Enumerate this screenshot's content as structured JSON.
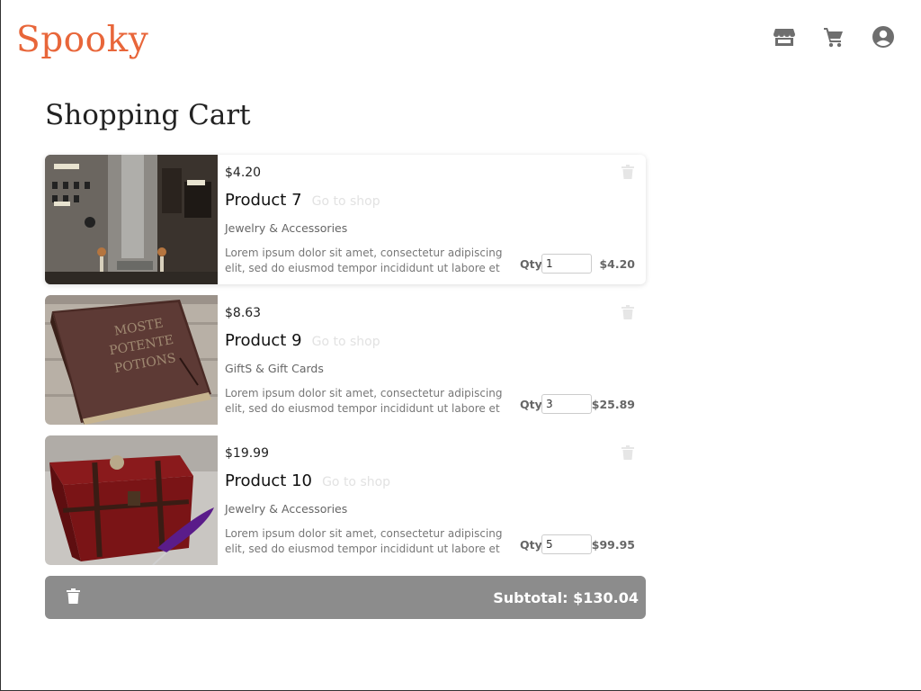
{
  "header": {
    "logo": "Spooky",
    "icons": [
      "store-icon",
      "cart-icon",
      "account-icon"
    ]
  },
  "page": {
    "title": "Shopping Cart"
  },
  "cart": {
    "items": [
      {
        "unit_price": "$4.20",
        "name": "Product 7",
        "shop_link": "Go to shop",
        "category": "Jewelry & Accessories",
        "description": "Lorem ipsum dolor sit amet, consectetur adipiscing elit, sed do eiusmod tempor incididunt ut labore et dolo...",
        "qty_label": "Qty",
        "qty": "1",
        "line_total": "$4.20",
        "image": "machine-image"
      },
      {
        "unit_price": "$8.63",
        "name": "Product 9",
        "shop_link": "Go to shop",
        "category": "GiftS & Gift Cards",
        "description": "Lorem ipsum dolor sit amet, consectetur adipiscing elit, sed do eiusmod tempor incididunt ut labore et dolo...",
        "qty_label": "Qty",
        "qty": "3",
        "line_total": "$25.89",
        "image": "potion-book-image"
      },
      {
        "unit_price": "$19.99",
        "name": "Product 10",
        "shop_link": "Go to shop",
        "category": "Jewelry & Accessories",
        "description": "Lorem ipsum dolor sit amet, consectetur adipiscing elit, sed do eiusmod tempor incididunt ut labore et dolo...",
        "qty_label": "Qty",
        "qty": "5",
        "line_total": "$99.95",
        "image": "treasure-chest-image"
      }
    ],
    "subtotal": "Subtotal: $130.04"
  },
  "colors": {
    "brand": "#e8663a",
    "subtotal_bar": "#8c8c8c",
    "icon_gray": "#6e6e6e",
    "muted_link": "#e2e2e2"
  }
}
